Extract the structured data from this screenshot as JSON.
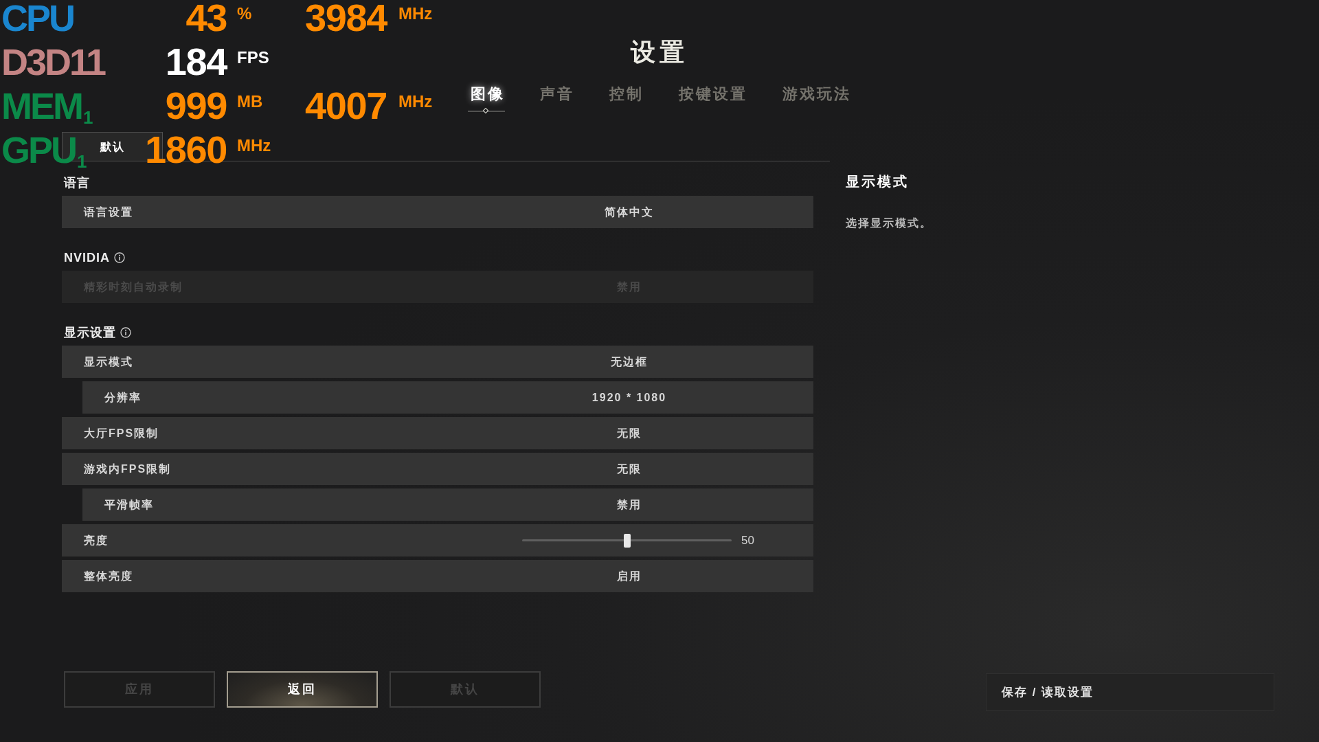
{
  "osd": {
    "rows": [
      {
        "kind": "sensor",
        "label": "CPU",
        "color": "#1a86cf",
        "value": "43",
        "unit": "%",
        "value_2": "3984",
        "unit_2": "MHz"
      },
      {
        "kind": "framerate",
        "label": "D3D11",
        "color": "#c48484",
        "value": "184",
        "unit": "FPS"
      },
      {
        "kind": "sensor",
        "label": "MEM$_{1}$",
        "color": "#0b8a49",
        "value": "999",
        "unit": "MB",
        "value_2": "4007",
        "unit_2": "MHz"
      },
      {
        "kind": "sensor",
        "label": "GPU$_{1}$",
        "color": "#0b8a49",
        "value": "1860",
        "unit": "MHz"
      }
    ]
  },
  "title": "设置",
  "tabs": [
    {
      "label": "图像",
      "selected": true
    },
    {
      "label": "声音",
      "selected": false
    },
    {
      "label": "控制",
      "selected": false
    },
    {
      "label": "按键设置",
      "selected": false
    },
    {
      "label": "游戏玩法",
      "selected": false
    }
  ],
  "preset_button": "默认",
  "sections": [
    {
      "heading": "语言",
      "info": false,
      "rows": [
        {
          "kind": "option",
          "label": "语言设置",
          "value": "简体中文",
          "disabled": false
        }
      ]
    },
    {
      "heading": "NVIDIA",
      "info": true,
      "rows": [
        {
          "kind": "option",
          "label": "精彩时刻自动录制",
          "value": "禁用",
          "disabled": true
        }
      ]
    },
    {
      "heading": "显示设置",
      "info": true,
      "rows": [
        {
          "kind": "option",
          "label": "显示模式",
          "value": "无边框",
          "disabled": false,
          "children": [
            {
              "kind": "option",
              "label": "分辨率",
              "value": "1920 * 1080",
              "disabled": false
            }
          ]
        },
        {
          "kind": "option",
          "label": "大厅FPS限制",
          "value": "无限",
          "disabled": false
        },
        {
          "kind": "option",
          "label": "游戏内FPS限制",
          "value": "无限",
          "disabled": false,
          "children": [
            {
              "kind": "option",
              "label": "平滑帧率",
              "value": "禁用",
              "disabled": false
            }
          ]
        },
        {
          "kind": "slider",
          "label": "亮度",
          "level": 0.5,
          "reading": "50",
          "disabled": false
        },
        {
          "kind": "option",
          "label": "整体亮度",
          "value": "启用",
          "disabled": false
        }
      ]
    }
  ],
  "detail_panel": {
    "title": "显示模式",
    "description": "选择显示模式。"
  },
  "buttons": [
    {
      "label": "应用",
      "disabled": true
    },
    {
      "label": "返回",
      "disabled": false
    },
    {
      "label": "默认",
      "disabled": true
    }
  ],
  "save_load_button": "保存 / 读取设置"
}
